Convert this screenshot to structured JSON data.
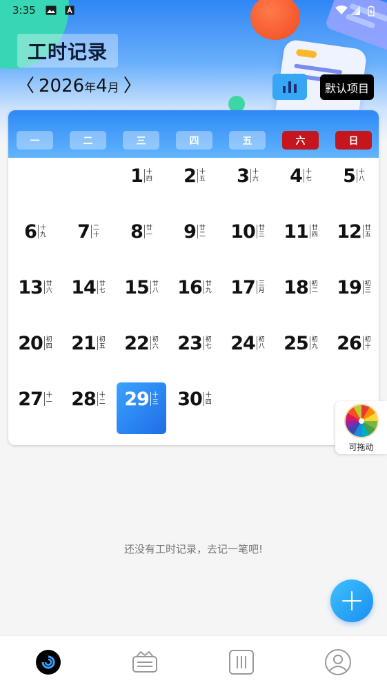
{
  "status_bar": {
    "time": "3:35",
    "icons": [
      "image-icon",
      "font-icon",
      "wifi-icon",
      "signal-icon",
      "battery-icon"
    ]
  },
  "header": {
    "title": "工时记录",
    "month_nav": {
      "year": "2026",
      "year_suffix": "年",
      "month": "4",
      "month_suffix": "月",
      "prev_icon": "chevron-left-icon",
      "next_icon": "chevron-right-icon"
    },
    "stats_icon": "bar-chart-icon",
    "project_button": "默认项目"
  },
  "calendar": {
    "weekdays": [
      {
        "label": "一",
        "weekend": false
      },
      {
        "label": "二",
        "weekend": false
      },
      {
        "label": "三",
        "weekend": false
      },
      {
        "label": "四",
        "weekend": false
      },
      {
        "label": "五",
        "weekend": false
      },
      {
        "label": "六",
        "weekend": true
      },
      {
        "label": "日",
        "weekend": true
      }
    ],
    "first_weekday_index": 2,
    "selected_day": 29,
    "days": [
      {
        "day": "1",
        "lunar": "十四"
      },
      {
        "day": "2",
        "lunar": "十五"
      },
      {
        "day": "3",
        "lunar": "十六"
      },
      {
        "day": "4",
        "lunar": "十七"
      },
      {
        "day": "5",
        "lunar": "十八"
      },
      {
        "day": "6",
        "lunar": "十九"
      },
      {
        "day": "7",
        "lunar": "二十"
      },
      {
        "day": "8",
        "lunar": "廿一"
      },
      {
        "day": "9",
        "lunar": "廿二"
      },
      {
        "day": "10",
        "lunar": "廿三"
      },
      {
        "day": "11",
        "lunar": "廿四"
      },
      {
        "day": "12",
        "lunar": "廿五"
      },
      {
        "day": "13",
        "lunar": "廿六"
      },
      {
        "day": "14",
        "lunar": "廿七"
      },
      {
        "day": "15",
        "lunar": "廿八"
      },
      {
        "day": "16",
        "lunar": "廿九"
      },
      {
        "day": "17",
        "lunar": "三月"
      },
      {
        "day": "18",
        "lunar": "初二"
      },
      {
        "day": "19",
        "lunar": "初三"
      },
      {
        "day": "20",
        "lunar": "初四"
      },
      {
        "day": "21",
        "lunar": "初五"
      },
      {
        "day": "22",
        "lunar": "初六"
      },
      {
        "day": "23",
        "lunar": "初七"
      },
      {
        "day": "24",
        "lunar": "初八"
      },
      {
        "day": "25",
        "lunar": "初九"
      },
      {
        "day": "26",
        "lunar": "初十"
      },
      {
        "day": "27",
        "lunar": "十一"
      },
      {
        "day": "28",
        "lunar": "十二"
      },
      {
        "day": "29",
        "lunar": "十三"
      },
      {
        "day": "30",
        "lunar": "十四"
      }
    ]
  },
  "floating_wheel": {
    "label": "可拖动",
    "icon": "prize-wheel-icon"
  },
  "empty_message": "还没有工时记录，去记一笔吧!",
  "fab_icon": "plus-icon",
  "bottom_nav": [
    {
      "name": "home",
      "icon": "home-logo-icon",
      "active": true
    },
    {
      "name": "records",
      "icon": "wallet-icon",
      "active": false
    },
    {
      "name": "stats",
      "icon": "columns-icon",
      "active": false
    },
    {
      "name": "profile",
      "icon": "user-icon",
      "active": false
    }
  ],
  "colors": {
    "primary": "#2f86f5",
    "weekend": "#c4161c",
    "fab": "#1a8ff0",
    "selected": "#1f6de6"
  }
}
